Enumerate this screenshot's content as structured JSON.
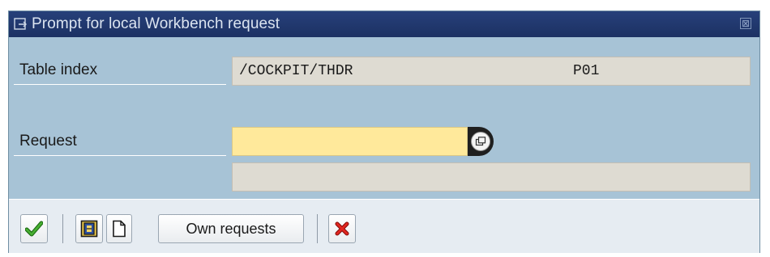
{
  "dialog": {
    "title": "Prompt for local Workbench request",
    "close_glyph": "⊠"
  },
  "fields": {
    "table_index_label": "Table index",
    "table_index_value": "/COCKPIT/THDR",
    "table_index_system": "P01",
    "request_label": "Request",
    "request_value": "",
    "request_description": ""
  },
  "toolbar": {
    "own_requests_label": "Own requests",
    "continue_icon": "checkmark-icon",
    "cancel_icon": "cancel-x-icon"
  },
  "colors": {
    "title_bar": "#1c3163",
    "dialog_bg": "#a7c3d6",
    "input_bg": "#ffe99b",
    "readonly_bg": "#dedbd2",
    "confirm_green": "#2f8f1f",
    "cancel_red": "#d0211c"
  }
}
